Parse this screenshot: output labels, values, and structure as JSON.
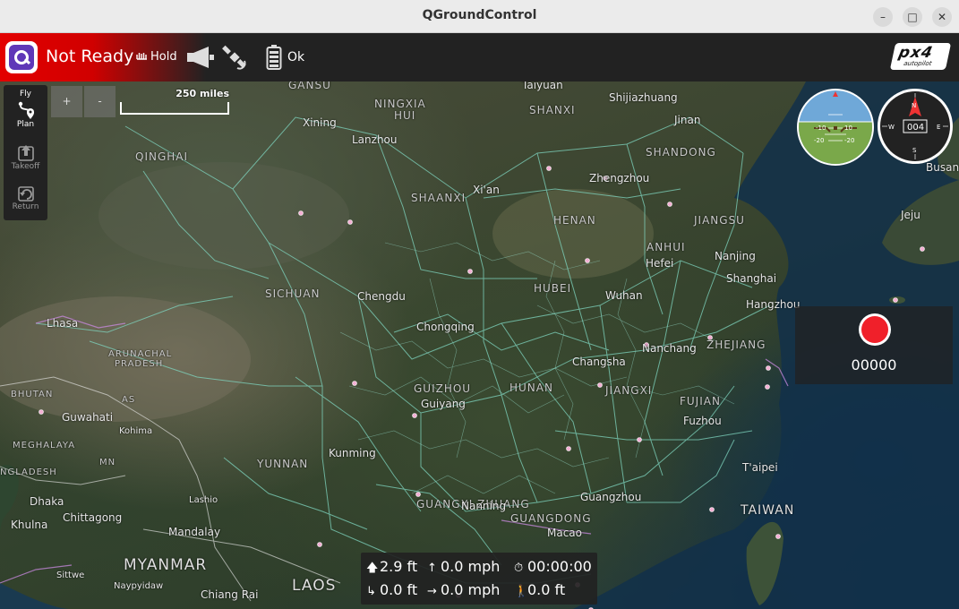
{
  "window": {
    "title": "QGroundControl",
    "min": "–",
    "max": "□",
    "close": "✕"
  },
  "toolbar": {
    "status": "Not Ready",
    "flight_mode": "Hold",
    "battery_status": "Ok",
    "vendor_logo": "px4",
    "vendor_sub": "autopilot"
  },
  "tools": {
    "fly": "Fly",
    "plan": "Plan",
    "takeoff": "Takeoff",
    "return": "Return"
  },
  "zoom": {
    "in": "+",
    "out": "-"
  },
  "scale": {
    "label": "250 miles"
  },
  "compass": {
    "heading": "004",
    "n": "N",
    "s": "S",
    "e": "E",
    "w": "W"
  },
  "attitude": {
    "ticks": [
      "-10",
      "10",
      "-20",
      "-20"
    ]
  },
  "record": {
    "time": "00000"
  },
  "telemetry": {
    "altitude": "2.9 ft",
    "ground_speed": "0.0 mph",
    "flight_time": "00:00:00",
    "distance": "0.0 ft",
    "climb_rate": "0.0 mph",
    "distance_home": "0.0 ft"
  },
  "map": {
    "labels": [
      {
        "t": "GANSU",
        "k": "region"
      },
      {
        "t": "NINGXIA",
        "k": "region"
      },
      {
        "t": "HUI",
        "k": "region"
      },
      {
        "t": "Taiyuan",
        "k": ""
      },
      {
        "t": "Shijiazhuang",
        "k": ""
      },
      {
        "t": "SHANXI",
        "k": "region"
      },
      {
        "t": "Jinan",
        "k": ""
      },
      {
        "t": "Xining",
        "k": ""
      },
      {
        "t": "Lanzhou",
        "k": ""
      },
      {
        "t": "QINGHAI",
        "k": "region"
      },
      {
        "t": "SHANDONG",
        "k": "region"
      },
      {
        "t": "Zhengzhou",
        "k": ""
      },
      {
        "t": "Xi'an",
        "k": ""
      },
      {
        "t": "SHAANXI",
        "k": "region"
      },
      {
        "t": "HENAN",
        "k": "region"
      },
      {
        "t": "JIANGSU",
        "k": "region"
      },
      {
        "t": "ANHUI",
        "k": "region"
      },
      {
        "t": "Nanjing",
        "k": ""
      },
      {
        "t": "Hefei",
        "k": ""
      },
      {
        "t": "Shanghai",
        "k": ""
      },
      {
        "t": "SICHUAN",
        "k": "region"
      },
      {
        "t": "Chengdu",
        "k": ""
      },
      {
        "t": "HUBEI",
        "k": "region"
      },
      {
        "t": "Wuhan",
        "k": ""
      },
      {
        "t": "Hangzhou",
        "k": ""
      },
      {
        "t": "Chongqing",
        "k": ""
      },
      {
        "t": "Lhasa",
        "k": ""
      },
      {
        "t": "Nanchang",
        "k": ""
      },
      {
        "t": "ZHEJIANG",
        "k": "region"
      },
      {
        "t": "Changsha",
        "k": ""
      },
      {
        "t": "ARUNACHAL",
        "k": "region-s"
      },
      {
        "t": "PRADESH",
        "k": "region-s"
      },
      {
        "t": "GUIZHOU",
        "k": "region"
      },
      {
        "t": "HUNAN",
        "k": "region"
      },
      {
        "t": "JIANGXI",
        "k": "region"
      },
      {
        "t": "BHUTAN",
        "k": "region-s"
      },
      {
        "t": "AS",
        "k": "region-s"
      },
      {
        "t": "FUJIAN",
        "k": "region"
      },
      {
        "t": "Guiyang",
        "k": ""
      },
      {
        "t": "Guwahati",
        "k": ""
      },
      {
        "t": "Kohima",
        "k": "small"
      },
      {
        "t": "Fuzhou",
        "k": ""
      },
      {
        "t": "MEGHALAYA",
        "k": "region-s"
      },
      {
        "t": "MN",
        "k": "region-s"
      },
      {
        "t": "YUNNAN",
        "k": "region"
      },
      {
        "t": "Kunming",
        "k": ""
      },
      {
        "t": "T'aipei",
        "k": ""
      },
      {
        "t": "NGLADESH",
        "k": "region-s"
      },
      {
        "t": "GUANGXI ZHUANG",
        "k": "region"
      },
      {
        "t": "Lashio",
        "k": "small"
      },
      {
        "t": "Dhaka",
        "k": ""
      },
      {
        "t": "Guangzhou",
        "k": ""
      },
      {
        "t": "Nanning",
        "k": ""
      },
      {
        "t": "GUANGDONG",
        "k": "region"
      },
      {
        "t": "TAIWAN",
        "k": "mid"
      },
      {
        "t": "Khulna",
        "k": ""
      },
      {
        "t": "Chittagong",
        "k": ""
      },
      {
        "t": "Mandalay",
        "k": ""
      },
      {
        "t": "Macao",
        "k": ""
      },
      {
        "t": "MYANMAR",
        "k": "big"
      },
      {
        "t": "Sittwe",
        "k": "small"
      },
      {
        "t": "Naypyidaw",
        "k": "small"
      },
      {
        "t": "Chiang Rai",
        "k": ""
      },
      {
        "t": "LAOS",
        "k": "big"
      },
      {
        "t": "Jeju",
        "k": ""
      },
      {
        "t": "Busan",
        "k": ""
      }
    ]
  },
  "colors": {
    "not_ready": "#e30000",
    "record": "#f0202a",
    "roads": "#7fd6c0"
  }
}
